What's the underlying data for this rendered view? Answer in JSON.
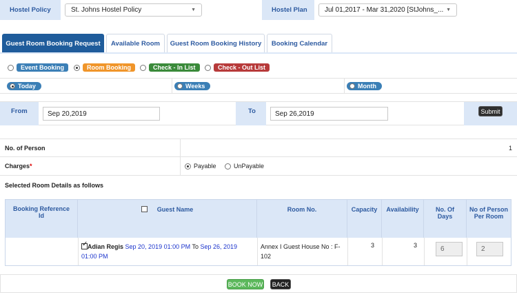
{
  "policy": {
    "hostel_policy_label": "Hostel Policy",
    "hostel_policy_value": "St. Johns Hostel Policy",
    "hostel_plan_label": "Hostel Plan",
    "hostel_plan_value": "Jul 01,2017 - Mar 31,2020 [StJohns_..."
  },
  "tabs": [
    {
      "label": "Guest Room Booking Request",
      "active": true
    },
    {
      "label": "Available Room"
    },
    {
      "label": "Guest Room Booking History"
    },
    {
      "label": "Booking Calendar"
    }
  ],
  "booking_types": [
    {
      "label": "Event Booking",
      "color": "#3b7fb6",
      "selected": false
    },
    {
      "label": "Room Booking",
      "color": "#f0952a",
      "selected": true
    },
    {
      "label": "Check - In List",
      "color": "#3a8a3a",
      "selected": false
    },
    {
      "label": "Check - Out List",
      "color": "#b73a3a",
      "selected": false
    }
  ],
  "period": {
    "today": "Today",
    "weeks": "Weeks",
    "month": "Month",
    "selected": "today"
  },
  "dates": {
    "from_label": "From",
    "from_value": "Sep 20,2019",
    "to_label": "To",
    "to_value": "Sep 26,2019",
    "submit": "Submit"
  },
  "form": {
    "persons_label": "No. of Person",
    "persons_value": "1",
    "charges_label": "Charges",
    "required_mark": "*",
    "payable": "Payable",
    "unpayable": "UnPayable",
    "charges_selected": "payable",
    "selected_rooms_heading": "Selected Room Details as follows"
  },
  "table": {
    "headers": [
      "Booking Reference Id",
      "Guest Name",
      "Room No.",
      "Capacity",
      "Availability",
      "No. Of Days",
      "No of Person Per Room"
    ],
    "row": {
      "booking_ref": "",
      "guest_name": "Adian Regis",
      "guest_from": "Sep 20, 2019 01:00 PM",
      "guest_to_word": "To",
      "guest_to": "Sep 26, 2019 01:00 PM",
      "room_no": "Annex I Guest House No : F-102",
      "capacity": "3",
      "availability": "3",
      "days": "6",
      "persons_per_room": "2"
    }
  },
  "actions": {
    "book_now": "BOOK NOW",
    "back": "BACK"
  },
  "colors": {
    "accent": "#1f5c9b",
    "header_bg": "#dbe7f7",
    "book_now": "#5cb85c",
    "back": "#222222"
  }
}
